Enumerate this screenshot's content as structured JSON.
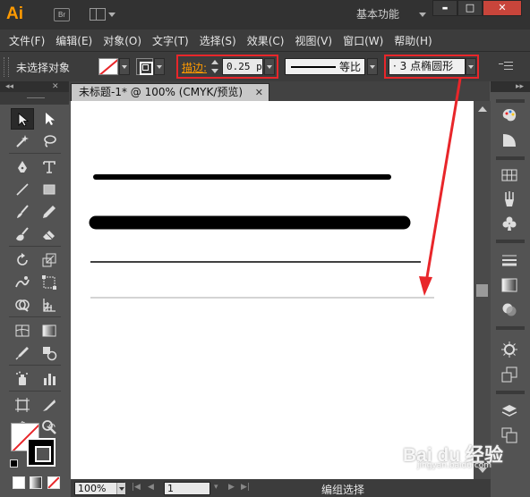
{
  "app": {
    "logo": "Ai",
    "bridge_label": "Br",
    "workspace": "基本功能"
  },
  "window_controls": {
    "minimize": "▬",
    "maximize": "□",
    "close": "✕"
  },
  "menu": [
    "文件(F)",
    "编辑(E)",
    "对象(O)",
    "文字(T)",
    "选择(S)",
    "效果(C)",
    "视图(V)",
    "窗口(W)",
    "帮助(H)"
  ],
  "control_bar": {
    "selection_status": "未选择对象",
    "stroke_label": "描边:",
    "stroke_weight": "0.25 p",
    "profile_label": "等比",
    "brush": "· 3 点椭圆形"
  },
  "document": {
    "tab_title": "未标题-1* @ 100% (CMYK/预览)",
    "tab_close": "✕"
  },
  "status": {
    "zoom": "100%",
    "page": "1",
    "text": "编组选择"
  },
  "tools": [
    "selection-tool",
    "direct-selection-tool",
    "magic-wand-tool",
    "lasso-tool",
    "pen-tool",
    "type-tool",
    "line-segment-tool",
    "rectangle-tool",
    "paintbrush-tool",
    "pencil-tool",
    "blob-brush-tool",
    "eraser-tool",
    "rotate-tool",
    "scale-tool",
    "warp-tool",
    "free-transform-tool",
    "shape-builder-tool",
    "perspective-grid-tool",
    "mesh-tool",
    "gradient-tool",
    "eyedropper-tool",
    "blend-tool",
    "symbol-sprayer-tool",
    "column-graph-tool",
    "artboard-tool",
    "slice-tool",
    "hand-tool",
    "zoom-tool"
  ],
  "colors": {
    "accent_orange": "#ff9a00",
    "highlight_red": "#e8262a",
    "ui_dark": "#535353",
    "canvas": "#ffffff"
  },
  "watermark": {
    "brand": "Bai du 经验",
    "url": "jingyan.baidu.com"
  }
}
